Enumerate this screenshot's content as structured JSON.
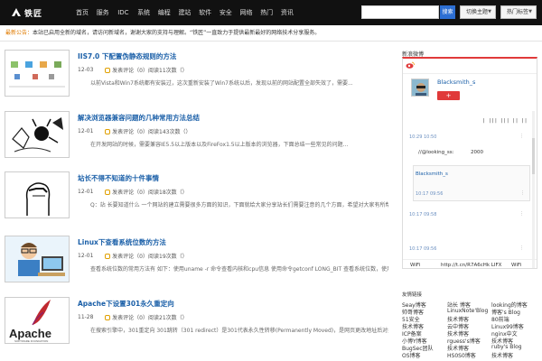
{
  "header": {
    "logo_text": "铁匠",
    "nav": [
      "首页",
      "服务",
      "IDC",
      "系统",
      "编程",
      "建站",
      "软件",
      "安全",
      "网络",
      "热门",
      "资讯"
    ],
    "search_placeholder": "",
    "search_button": "搜索",
    "dropdown1": "切换主题",
    "dropdown2": "热门标签"
  },
  "notice": {
    "highlight": "最新公告：",
    "text": "本站已启用全新的域名，请访问新域名，谢谢大家的支持与理解。“铁匠”一直致力于提供最新最好的网络技术分享服务。"
  },
  "posts": [
    {
      "title": "IIS7.0 下配置伪静态规则的方法",
      "date": "12-03",
      "comments": "发表评论（0）",
      "views": "阅读11次数（）",
      "excerpt": "以前Vista和Win7系统都有安装过，这次重新安装了Win7系统以后，发现以前的网站配置全部失效了，需要..."
    },
    {
      "title": "解决浏览器兼容问题的几种常用方法总结",
      "date": "12-01",
      "comments": "发表评论（0）",
      "views": "阅读143次数（）",
      "excerpt": "在开发网站的时候，需要兼容IE5.5以上版本以及FireFox1.5以上版本的浏览器，下面总结一些常见的问题..."
    },
    {
      "title": "站长不得不知道的十件事情",
      "date": "12-01",
      "comments": "发表评论（0）",
      "views": "阅读18次数（）",
      "excerpt": "Q：站 长要知道什么   一个网站的建立需要很多方面的知识，下面就给大家分享站长们需要注意的几个方面，希望对大家有所帮助（7/8）..."
    },
    {
      "title": "Linux下查看系统位数的方法",
      "date": "12-01",
      "comments": "发表评论（0）",
      "views": "阅读19次数（）",
      "excerpt": "查看系统位数的常用方法有 如下：使用uname -r 命令查看内核和cpu信息 使用命令getconf LONG_BIT 查看系统位数，使用CPU的..."
    },
    {
      "title": "Apache下设置301永久重定向",
      "date": "11-28",
      "comments": "发表评论（0）",
      "views": "阅读21次数（）",
      "excerpt": "在搜索引擎中，301重定向 301跳转（301 redirect）是301代表永久性转移(Permanently Moved)，是网页更改地址后对搜..."
    }
  ],
  "sidebar": {
    "weibo_title": "新浪微博",
    "weibo_name": "Blacksmith_s",
    "follow_label": "+",
    "ascii_art": "|  |||  |||  ||  ||",
    "times": [
      "10:29  10:50",
      "10:17  09:56",
      "10:17  09:58",
      "10:17  09:56"
    ],
    "feed_text1": "//@looking_ss:",
    "feed_text1_num": "2000",
    "card_name": "Blacksmith_s",
    "footer_text1": "WiFi",
    "footer_link": "http://t.cn/R7A6cHk LIFX",
    "footer_text2": "WiFi",
    "links_title": "友情链接",
    "links": [
      "Seay博客",
      "站长 博客",
      "looking的博客",
      "帅哥博客",
      "LinuxNote'Blog",
      "博客's Blog",
      "51安全",
      "技术博客",
      "80前端",
      "技术博客",
      "云中博客",
      "Linux99博客",
      "ICP备案",
      "技术博客",
      "nginx中文",
      "小博Y博客",
      "rguess's博客",
      "技术博客",
      "BugSec团队",
      "技术博客",
      "ruby's Blog",
      "OS博客",
      "HS0S0博客",
      "技术博客"
    ]
  },
  "colors": {
    "topbar": "#111111",
    "link_blue": "#1a5fa8",
    "accent_orange": "#e07b00",
    "weibo_red": "#e03a3a",
    "search_blue": "#2d6fd3"
  }
}
